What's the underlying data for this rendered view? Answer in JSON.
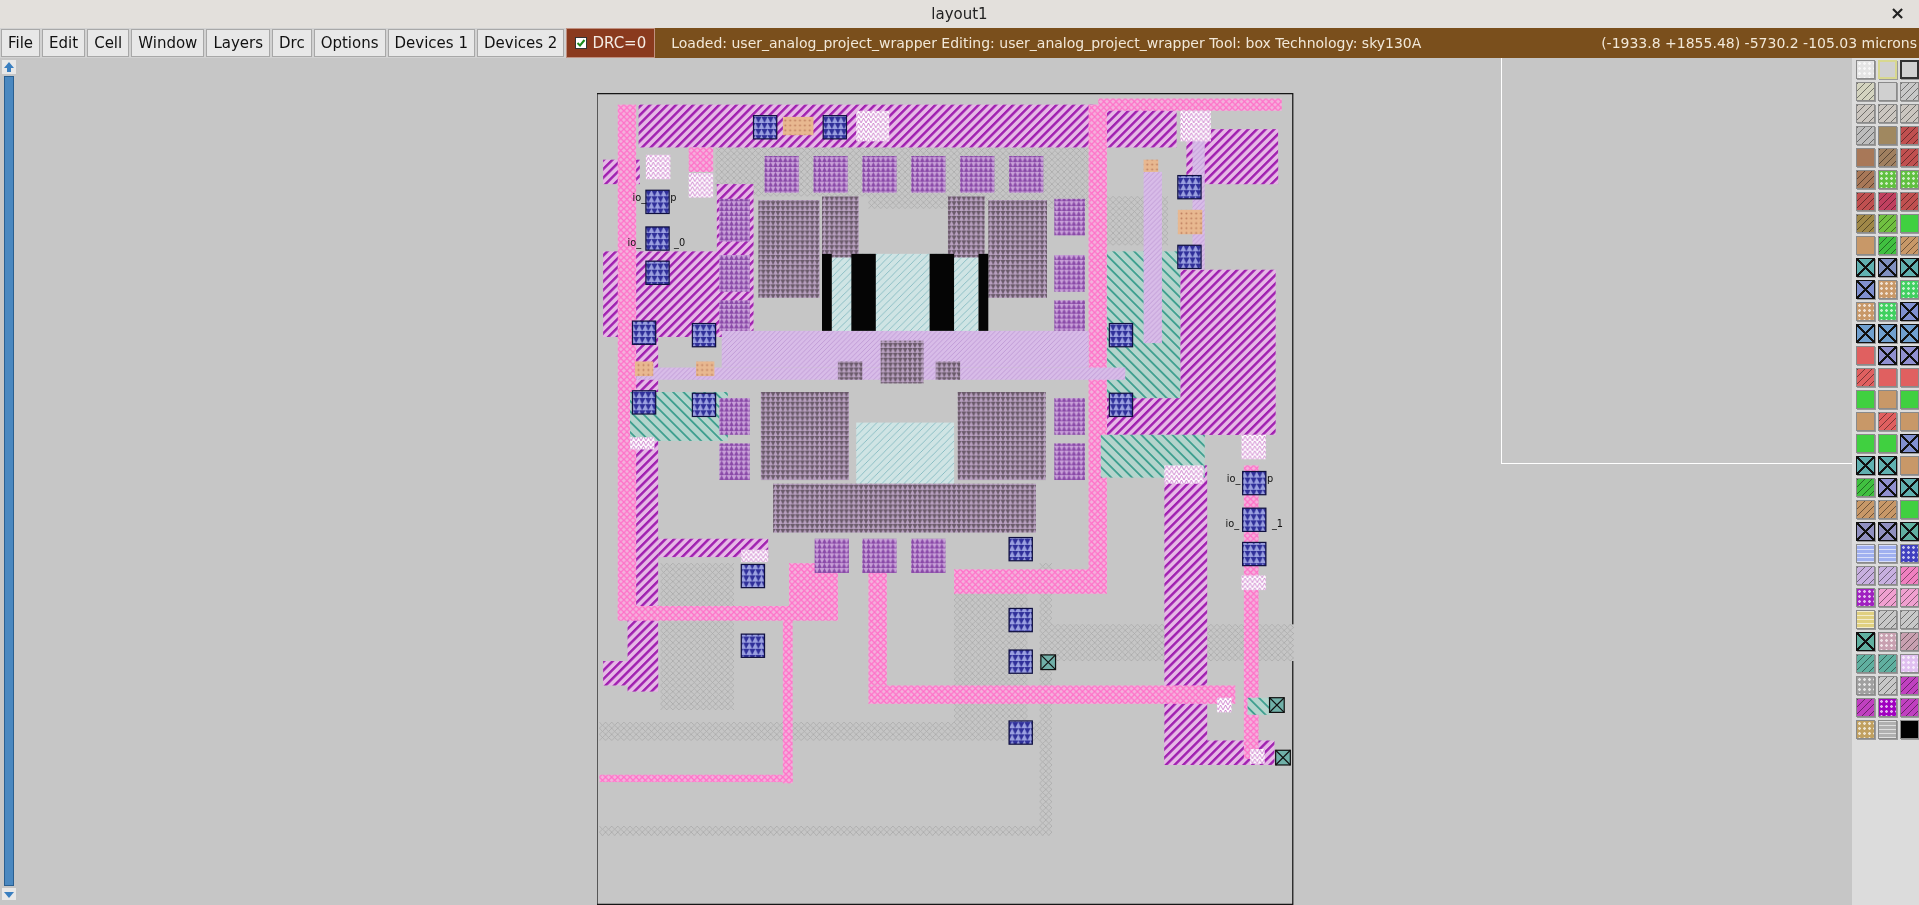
{
  "window": {
    "title": "layout1",
    "close": "×"
  },
  "menu": [
    "File",
    "Edit",
    "Cell",
    "Window",
    "Layers",
    "Drc",
    "Options",
    "Devices 1",
    "Devices 2"
  ],
  "drc": {
    "label": "DRC=0",
    "checked": true
  },
  "status": {
    "message": "Loaded: user_analog_project_wrapper Editing: user_analog_project_wrapper Tool: box  Technology: sky130A",
    "coordinates": "(-1933.8 +1855.48) -5730.2 -105.03 microns"
  },
  "layout": {
    "labels": [
      "io_",
      "p",
      "io_",
      "_0",
      "io_",
      "p",
      "io_",
      "_1"
    ]
  },
  "palette": [
    {
      "color": "#e4e4e4",
      "kind": "dots"
    },
    {
      "color": "#d8d890",
      "kind": "outline"
    },
    {
      "color": "#303030",
      "kind": "outline"
    },
    {
      "color": "#d4d4c0",
      "kind": "hatch"
    },
    {
      "color": "#d0d0d0",
      "kind": "solid"
    },
    {
      "color": "#c8c8c8",
      "kind": "hatch"
    },
    {
      "color": "#cbc6c0",
      "kind": "hatch"
    },
    {
      "color": "#cbc6c0",
      "kind": "hatch"
    },
    {
      "color": "#cbc6c0",
      "kind": "hatch"
    },
    {
      "color": "#bdbdbd",
      "kind": "hatch"
    },
    {
      "color": "#a08860",
      "kind": "solid"
    },
    {
      "color": "#c05050",
      "kind": "hatch"
    },
    {
      "color": "#a87858",
      "kind": "solid"
    },
    {
      "color": "#a08060",
      "kind": "hatch"
    },
    {
      "color": "#c05050",
      "kind": "hatch"
    },
    {
      "color": "#a87858",
      "kind": "hatch"
    },
    {
      "color": "#60c040",
      "kind": "dots"
    },
    {
      "color": "#60c040",
      "kind": "dots"
    },
    {
      "color": "#c05050",
      "kind": "hatch"
    },
    {
      "color": "#c04060",
      "kind": "hatch"
    },
    {
      "color": "#c05050",
      "kind": "hatch"
    },
    {
      "color": "#a08848",
      "kind": "hatch"
    },
    {
      "color": "#70c040",
      "kind": "hatch"
    },
    {
      "color": "#40d040",
      "kind": "solid"
    },
    {
      "color": "#c89868",
      "kind": "solid"
    },
    {
      "color": "#40c040",
      "kind": "hatch"
    },
    {
      "color": "#c89868",
      "kind": "hatch"
    },
    {
      "color": "#60b0b0",
      "kind": "cross"
    },
    {
      "color": "#8090c0",
      "kind": "cross"
    },
    {
      "color": "#60b0b0",
      "kind": "cross"
    },
    {
      "color": "#8090d0",
      "kind": "cross"
    },
    {
      "color": "#c89868",
      "kind": "dots"
    },
    {
      "color": "#40d060",
      "kind": "dots"
    },
    {
      "color": "#c89868",
      "kind": "dots"
    },
    {
      "color": "#40d060",
      "kind": "dots"
    },
    {
      "color": "#8090d0",
      "kind": "cross"
    },
    {
      "color": "#70a0d0",
      "kind": "cross"
    },
    {
      "color": "#70a0d0",
      "kind": "cross"
    },
    {
      "color": "#70a0d0",
      "kind": "cross"
    },
    {
      "color": "#e06060",
      "kind": "solid"
    },
    {
      "color": "#9090d0",
      "kind": "cross"
    },
    {
      "color": "#9090d0",
      "kind": "cross"
    },
    {
      "color": "#e06060",
      "kind": "hatch"
    },
    {
      "color": "#e06060",
      "kind": "solid"
    },
    {
      "color": "#e06060",
      "kind": "solid"
    },
    {
      "color": "#40d040",
      "kind": "solid"
    },
    {
      "color": "#c89868",
      "kind": "solid"
    },
    {
      "color": "#40d040",
      "kind": "solid"
    },
    {
      "color": "#c89868",
      "kind": "solid"
    },
    {
      "color": "#e06060",
      "kind": "hatch"
    },
    {
      "color": "#c89868",
      "kind": "solid"
    },
    {
      "color": "#40d040",
      "kind": "solid"
    },
    {
      "color": "#40d040",
      "kind": "solid"
    },
    {
      "color": "#8090d0",
      "kind": "cross"
    },
    {
      "color": "#60b0b0",
      "kind": "cross"
    },
    {
      "color": "#60b0b0",
      "kind": "cross"
    },
    {
      "color": "#c89868",
      "kind": "solid"
    },
    {
      "color": "#40c040",
      "kind": "hatch"
    },
    {
      "color": "#9090d0",
      "kind": "cross"
    },
    {
      "color": "#60b0b0",
      "kind": "cross"
    },
    {
      "color": "#c89868",
      "kind": "hatch"
    },
    {
      "color": "#c89868",
      "kind": "hatch"
    },
    {
      "color": "#40d040",
      "kind": "solid"
    },
    {
      "color": "#9090c0",
      "kind": "cross"
    },
    {
      "color": "#9090c0",
      "kind": "cross"
    },
    {
      "color": "#60b0a0",
      "kind": "cross"
    },
    {
      "color": "#a0b0f0",
      "kind": "wave"
    },
    {
      "color": "#a0b0f0",
      "kind": "wave"
    },
    {
      "color": "#4040c0",
      "kind": "dots"
    },
    {
      "color": "#c8b0e0",
      "kind": "hatch"
    },
    {
      "color": "#c8b0e0",
      "kind": "hatch"
    },
    {
      "color": "#f080c0",
      "kind": "hatch"
    },
    {
      "color": "#a020c0",
      "kind": "dots"
    },
    {
      "color": "#f0a0d0",
      "kind": "hatch"
    },
    {
      "color": "#f0a0d0",
      "kind": "hatch"
    },
    {
      "color": "#e0d080",
      "kind": "wave"
    },
    {
      "color": "#c8c8c8",
      "kind": "hatch"
    },
    {
      "color": "#c8c8c8",
      "kind": "hatch"
    },
    {
      "color": "#60b0a0",
      "kind": "cross"
    },
    {
      "color": "#c8a0b0",
      "kind": "dots"
    },
    {
      "color": "#c8a0b0",
      "kind": "hatch"
    },
    {
      "color": "#60b0a0",
      "kind": "hatch"
    },
    {
      "color": "#60b0a0",
      "kind": "hatch"
    },
    {
      "color": "#e0c0f0",
      "kind": "dots"
    },
    {
      "color": "#a0a0a0",
      "kind": "dots"
    },
    {
      "color": "#c8c8c8",
      "kind": "hatch"
    },
    {
      "color": "#c040c0",
      "kind": "hatch"
    },
    {
      "color": "#c040c0",
      "kind": "hatch"
    },
    {
      "color": "#a000c0",
      "kind": "dots"
    },
    {
      "color": "#c040c0",
      "kind": "hatch"
    },
    {
      "color": "#c0a060",
      "kind": "dots"
    },
    {
      "color": "#b0b0b0",
      "kind": "wave"
    },
    {
      "color": "#000000",
      "kind": "solid"
    }
  ]
}
